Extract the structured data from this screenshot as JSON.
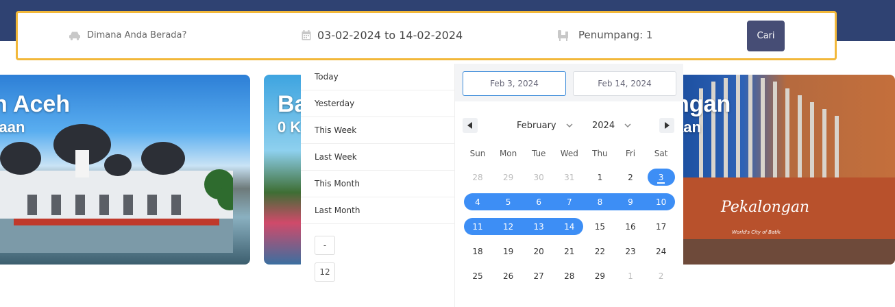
{
  "search": {
    "location_placeholder": "Dimana Anda Berada?",
    "date_range": "03-02-2024 to 14-02-2024",
    "passengers": "Penumpang: 1",
    "search_label": "Cari"
  },
  "cards": [
    {
      "title": "n Aceh",
      "subtitle": "raan"
    },
    {
      "title": "Ba",
      "subtitle": "0 K"
    },
    {
      "title": "ngan",
      "subtitle": "aan"
    }
  ],
  "city_sign": {
    "name": "Pekalongan",
    "motto": "World's City of Batik"
  },
  "picker": {
    "ranges": [
      "Today",
      "Yesterday",
      "This Week",
      "Last Week",
      "This Month",
      "Last Month"
    ],
    "minus_label": "-",
    "days_input": "12",
    "start_input": "Feb 3, 2024",
    "end_input": "Feb 14, 2024",
    "month": "February",
    "year": "2024",
    "prev_icon": "caret-left-icon",
    "next_icon": "caret-right-icon",
    "weekdays": [
      "Sun",
      "Mon",
      "Tue",
      "Wed",
      "Thu",
      "Fri",
      "Sat"
    ],
    "weeks": [
      [
        "28",
        "29",
        "30",
        "31",
        "1",
        "2",
        "3"
      ],
      [
        "4",
        "5",
        "6",
        "7",
        "8",
        "9",
        "10"
      ],
      [
        "11",
        "12",
        "13",
        "14",
        "15",
        "16",
        "17"
      ],
      [
        "18",
        "19",
        "20",
        "21",
        "22",
        "23",
        "24"
      ],
      [
        "25",
        "26",
        "27",
        "28",
        "29",
        "1",
        "2"
      ]
    ],
    "accent_color": "#3d8ef5"
  }
}
